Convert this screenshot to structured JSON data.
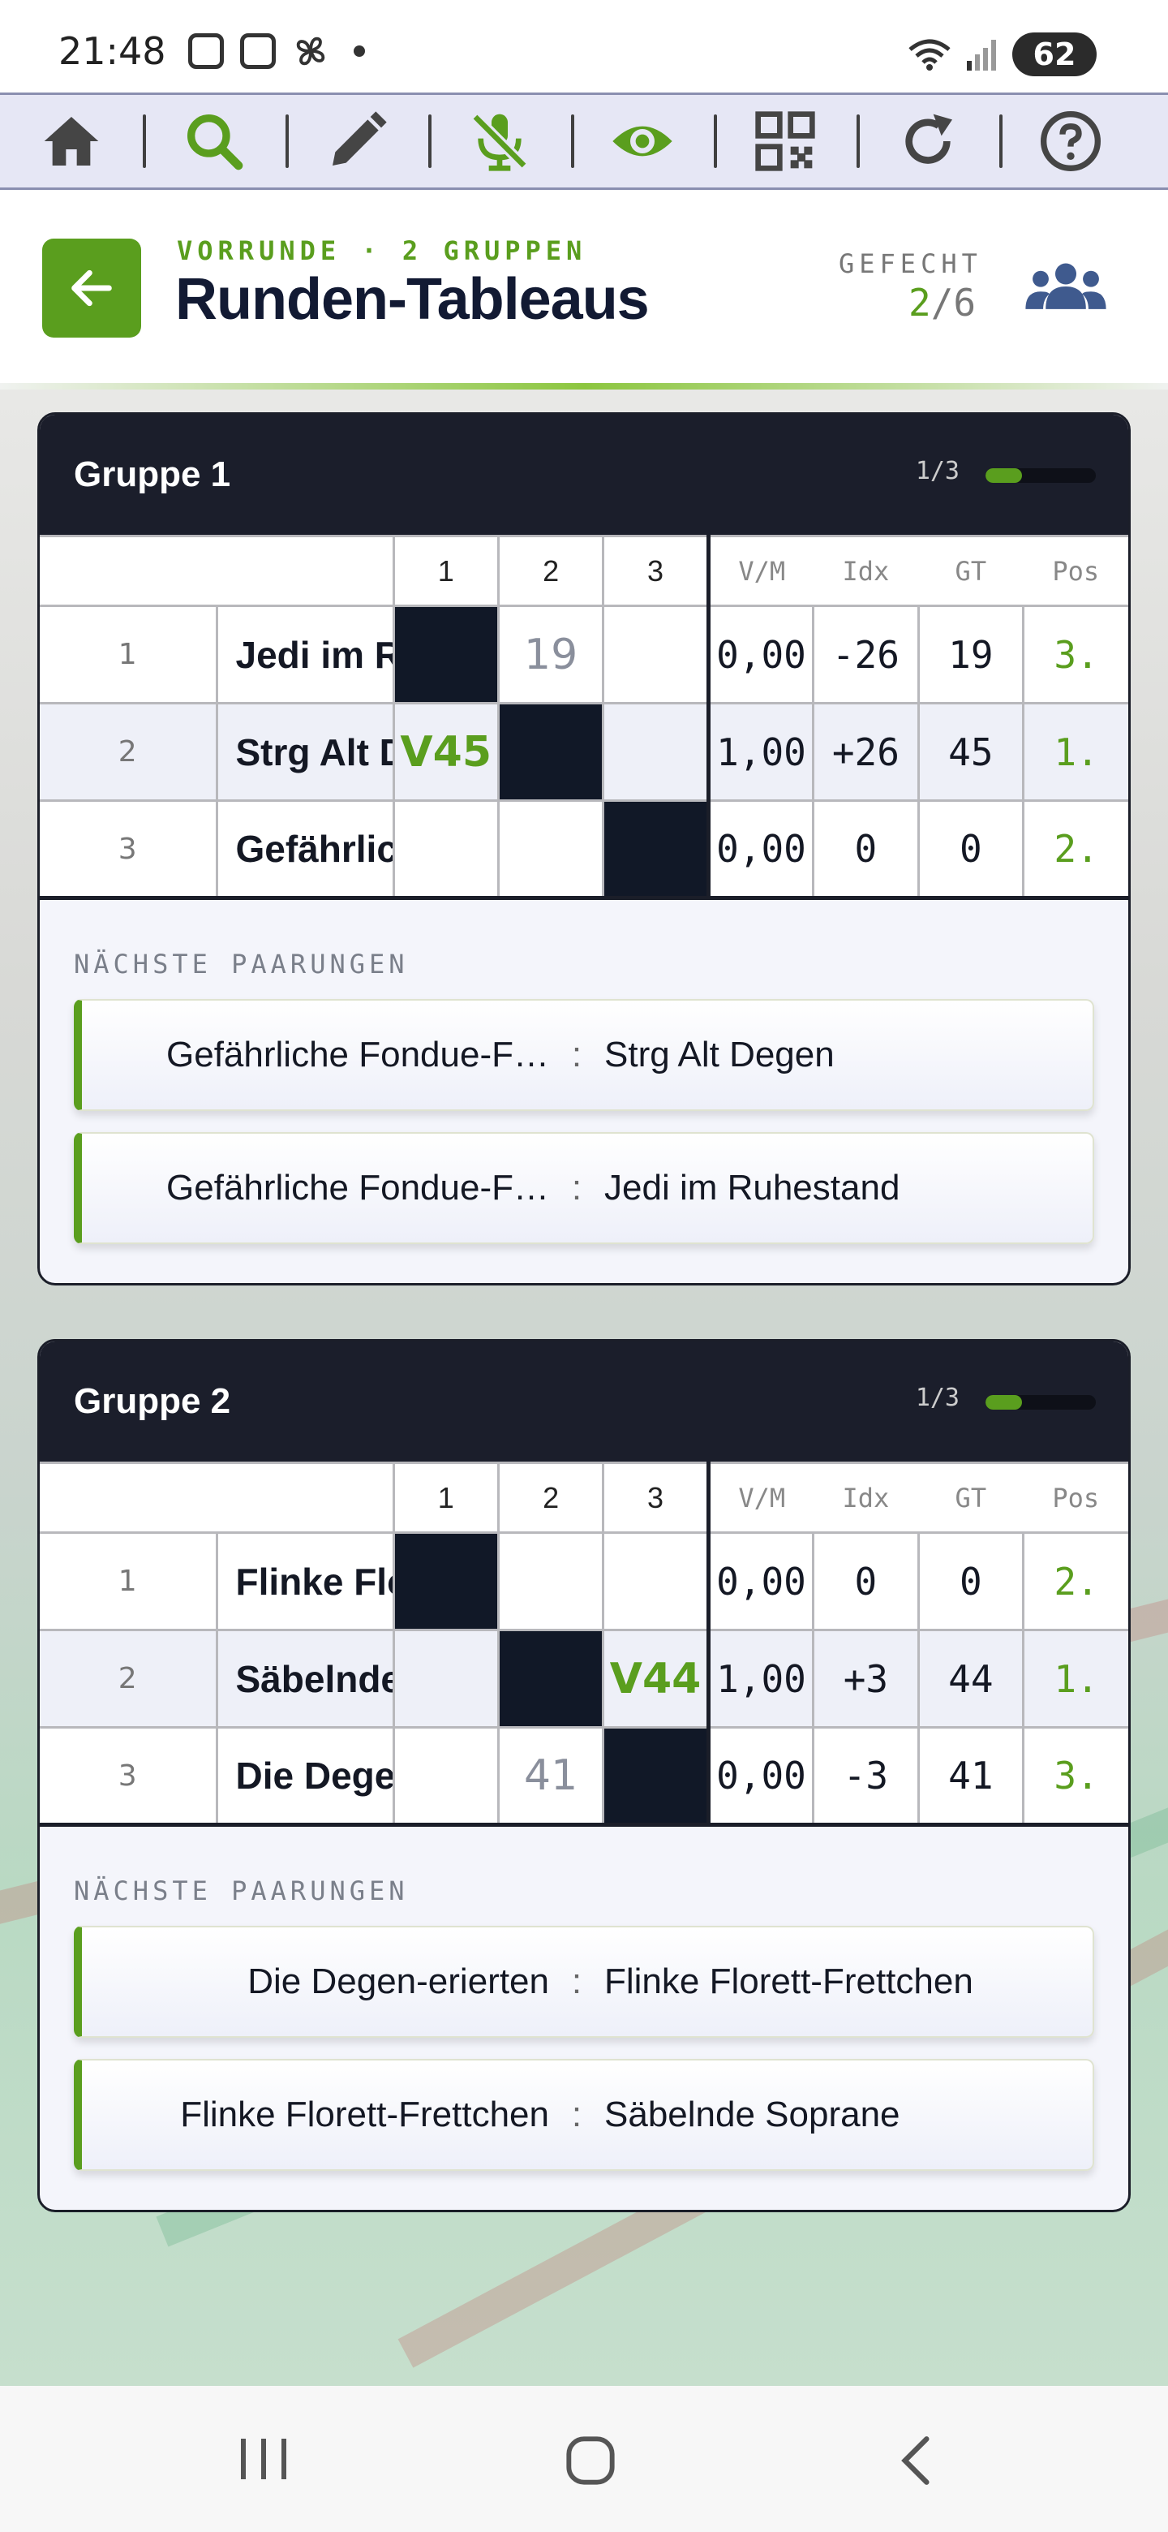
{
  "status_bar": {
    "time": "21:48",
    "battery": "62",
    "icons": [
      "screenshot-icon",
      "instagram-icon",
      "fan-icon",
      "dot-icon",
      "wifi-icon",
      "signal-icon",
      "battery-icon"
    ]
  },
  "toolbar": {
    "items": [
      {
        "name": "home-icon",
        "color": "#444444"
      },
      {
        "name": "search-icon",
        "color": "#5a9e1e"
      },
      {
        "name": "pencil-icon",
        "color": "#444444"
      },
      {
        "name": "mic-off-icon",
        "color": "#5a9e1e"
      },
      {
        "name": "eye-icon",
        "color": "#5a9e1e"
      },
      {
        "name": "qr-code-icon",
        "color": "#444444"
      },
      {
        "name": "refresh-icon",
        "color": "#444444"
      },
      {
        "name": "help-icon",
        "color": "#444444"
      }
    ]
  },
  "header": {
    "subtitle": "VORRUNDE · 2 GRUPPEN",
    "title": "Runden-Tableaus",
    "gefecht_label": "GEFECHT",
    "gefecht_current": "2",
    "gefecht_total": "/6",
    "accent": "#5a9e1e"
  },
  "groups": [
    {
      "title": "Gruppe 1",
      "progress_text": "1/3",
      "progress": 0.33,
      "columns": [
        "1",
        "2",
        "3"
      ],
      "stat_headers": [
        "V/M",
        "Idx",
        "GT",
        "Pos"
      ],
      "rows": [
        {
          "idx": "1",
          "name": "Jedi im R…",
          "cells": [
            "",
            "19",
            ""
          ],
          "vm": "0,00",
          "ind": "-26",
          "gt": "19",
          "pos": "3."
        },
        {
          "idx": "2",
          "name": "Strg Alt D…",
          "cells": [
            "V45",
            "",
            ""
          ],
          "vm": "1,00",
          "ind": "+26",
          "gt": "45",
          "pos": "1."
        },
        {
          "idx": "3",
          "name": "Gefährlich…",
          "cells": [
            "",
            "",
            ""
          ],
          "vm": "0,00",
          "ind": "0",
          "gt": "0",
          "pos": "2."
        }
      ],
      "pairs_label": "NÄCHSTE PAARUNGEN",
      "pairs": [
        {
          "a": "Gefährliche Fondue-F…",
          "sep": ":",
          "b": "Strg Alt Degen"
        },
        {
          "a": "Gefährliche Fondue-F…",
          "sep": ":",
          "b": "Jedi im Ruhestand"
        }
      ]
    },
    {
      "title": "Gruppe 2",
      "progress_text": "1/3",
      "progress": 0.33,
      "columns": [
        "1",
        "2",
        "3"
      ],
      "stat_headers": [
        "V/M",
        "Idx",
        "GT",
        "Pos"
      ],
      "rows": [
        {
          "idx": "1",
          "name": "Flinke Flo…",
          "cells": [
            "",
            "",
            ""
          ],
          "vm": "0,00",
          "ind": "0",
          "gt": "0",
          "pos": "2."
        },
        {
          "idx": "2",
          "name": "Säbelnde …",
          "cells": [
            "",
            "",
            "V44"
          ],
          "vm": "1,00",
          "ind": "+3",
          "gt": "44",
          "pos": "1."
        },
        {
          "idx": "3",
          "name": "Die Degen…",
          "cells": [
            "",
            "41",
            ""
          ],
          "vm": "0,00",
          "ind": "-3",
          "gt": "41",
          "pos": "3."
        }
      ],
      "pairs_label": "NÄCHSTE PAARUNGEN",
      "pairs": [
        {
          "a": "Die Degen-erierten",
          "sep": ":",
          "b": "Flinke Florett-Frettchen"
        },
        {
          "a": "Flinke Florett-Frettchen",
          "sep": ":",
          "b": "Säbelnde Soprane"
        }
      ]
    }
  ],
  "nav": {
    "items": [
      "recent-apps-icon",
      "home-circle-icon",
      "back-icon"
    ]
  }
}
